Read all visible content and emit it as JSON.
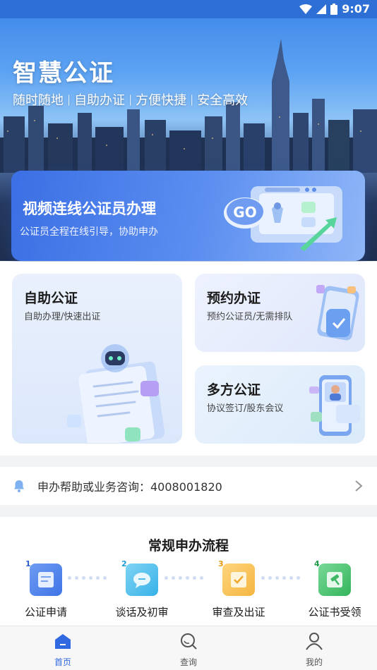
{
  "status_bar": {
    "time": "9:07"
  },
  "hero": {
    "title": "智慧公证",
    "taglines": [
      "随时随地",
      "自助办证",
      "方便快捷",
      "安全高效"
    ],
    "separator": "|"
  },
  "video_banner": {
    "title": "视频连线公证员办理",
    "subtitle": "公证员全程在线引导，协助申办",
    "badge": "GO"
  },
  "services": {
    "self_service": {
      "title": "自助公证",
      "subtitle": "自助办理/快速出证"
    },
    "appointment": {
      "title": "预约办证",
      "subtitle": "预约公证员/无需排队"
    },
    "multi_party": {
      "title": "多方公证",
      "subtitle": "协议签订/股东会议"
    }
  },
  "help": {
    "text": "申办帮助或业务咨询：4008001820"
  },
  "process": {
    "title": "常规申办流程",
    "steps": [
      {
        "num": "1",
        "label": "公证申请",
        "color": "#3f74e6",
        "num_color": "#2d5fd0"
      },
      {
        "num": "2",
        "label": "谈话及初审",
        "color": "#37b2e8",
        "num_color": "#1f9bd6"
      },
      {
        "num": "3",
        "label": "审查及出证",
        "color": "#f4b53f",
        "num_color": "#e79b12"
      },
      {
        "num": "4",
        "label": "公证书受领",
        "color": "#34b55c",
        "num_color": "#1f9a45"
      }
    ]
  },
  "tabbar": {
    "tabs": [
      {
        "label": "首页",
        "icon": "home-icon",
        "active": true
      },
      {
        "label": "查询",
        "icon": "search-icon",
        "active": false
      },
      {
        "label": "我的",
        "icon": "user-icon",
        "active": false
      }
    ]
  },
  "colors": {
    "accent": "#3069e0",
    "banner": "#4d82ec"
  }
}
